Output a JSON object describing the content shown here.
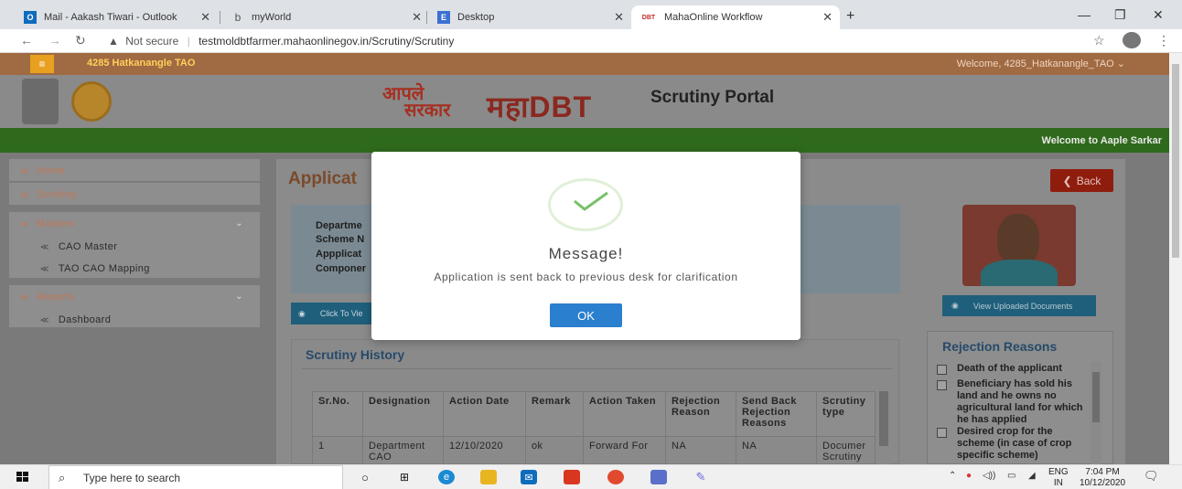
{
  "browser": {
    "tabs": [
      {
        "title": "Mail - Aakash Tiwari - Outlook",
        "icon": "outlook-icon"
      },
      {
        "title": "myWorld",
        "icon": "myworld-icon"
      },
      {
        "title": "Desktop",
        "icon": "desktop-icon"
      },
      {
        "title": "MahaOnline Workflow",
        "icon": "dbt-icon",
        "active": true
      }
    ],
    "dbt_fav": "DBT",
    "security_label": "Not secure",
    "url": "testmoldbtfarmer.mahaonlinegov.in/Scrutiny/Scrutiny"
  },
  "header": {
    "office": "4285 Hatkanangle TAO",
    "welcome": "Welcome, 4285_Hatkanangle_TAO",
    "aaple_top": "आपले",
    "aaple_bottom": "सरकार",
    "brand": "महाDBT",
    "portal": "Scrutiny Portal",
    "marquee": "Welcome to Aaple Sarkar"
  },
  "sidebar": {
    "home": "Home",
    "scrutiny": "Scrutiny",
    "masters": "Masters",
    "masters_items": [
      "CAO Master",
      "TAO CAO Mapping"
    ],
    "reports": "Reports",
    "reports_items": [
      "Dashboard"
    ]
  },
  "main": {
    "title": "Applicat",
    "info_labels": [
      "Departme",
      "Scheme N",
      "Appplicat",
      "Componer"
    ],
    "view_button": "Click To Vie",
    "back_button": "Back",
    "docs_button": "View Uploaded Documents",
    "history_title": "Scrutiny History",
    "table": {
      "headers": [
        "Sr.No.",
        "Designation",
        "Action Date",
        "Remark",
        "Action Taken",
        "Rejection Reason",
        "Send Back Rejection Reasons",
        "Scrutiny type"
      ],
      "rows": [
        [
          "1",
          "Department CAO",
          "12/10/2020",
          "ok",
          "Forward For",
          "NA",
          "NA",
          "Documer Scrutiny"
        ]
      ]
    },
    "rejection_title": "Rejection Reasons",
    "rejection_reasons": [
      "Death of the applicant",
      "Beneficiary has sold his land and he owns no agricultural land for which he has applied",
      "Desired crop for the scheme (in case of crop specific scheme)"
    ]
  },
  "modal": {
    "title": "Message!",
    "text": "Application is sent back to previous desk for clarification",
    "ok": "OK"
  },
  "taskbar": {
    "search_placeholder": "Type here to search",
    "lang_top": "ENG",
    "lang_bottom": "IN",
    "time": "7:04 PM",
    "date": "10/12/2020"
  }
}
